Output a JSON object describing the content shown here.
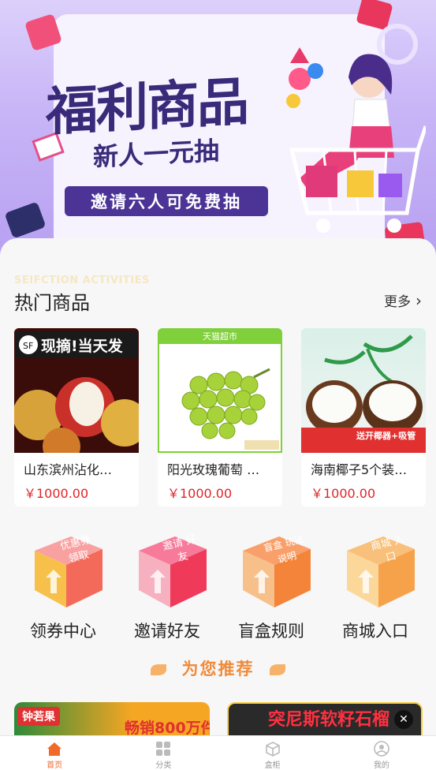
{
  "banner": {
    "title": "福利商品",
    "subtitle": "新人一元抽",
    "button": "邀请六人可免费抽"
  },
  "hot": {
    "section_en": "SEIFCTION ACTIVITIES",
    "section_title": "热门商品",
    "more_label": "更多",
    "items": [
      {
        "name": "山东滨州沾化…",
        "price": "￥1000.00",
        "image_text": "现摘!当天发"
      },
      {
        "name": "阳光玫瑰葡萄 …",
        "price": "￥1000.00",
        "image_text": "天猫超市"
      },
      {
        "name": "海南椰子5个装…",
        "price": "￥1000.00",
        "image_text": "送开椰器+吸管"
      }
    ]
  },
  "shortcuts": [
    {
      "label": "领券中心",
      "cube_text": "优惠券 领取",
      "color": "#f36a5a"
    },
    {
      "label": "邀请好友",
      "cube_text": "邀请 好友",
      "color": "#f04a6a"
    },
    {
      "label": "盲盒规则",
      "cube_text": "盲盒 玩法说明",
      "color": "#f3843a"
    },
    {
      "label": "商城入口",
      "cube_text": "商城 入口",
      "color": "#f6a24a"
    }
  ],
  "recommend": {
    "title": "为您推荐",
    "left_badge": "钟若果",
    "left_text": "畅销800万件",
    "right_text": "突尼斯软籽石榴",
    "close_icon": "close-icon"
  },
  "tabbar": {
    "items": [
      {
        "label": "首页",
        "icon": "home-icon",
        "active": true
      },
      {
        "label": "分类",
        "icon": "grid-icon",
        "active": false
      },
      {
        "label": "盒柜",
        "icon": "box-icon",
        "active": false
      },
      {
        "label": "我的",
        "icon": "user-icon",
        "active": false
      }
    ]
  },
  "colors": {
    "accent": "#f06a2a",
    "price": "#e0242a",
    "hero_bg": "#c9b6f7",
    "banner_button": "#4b3496"
  }
}
